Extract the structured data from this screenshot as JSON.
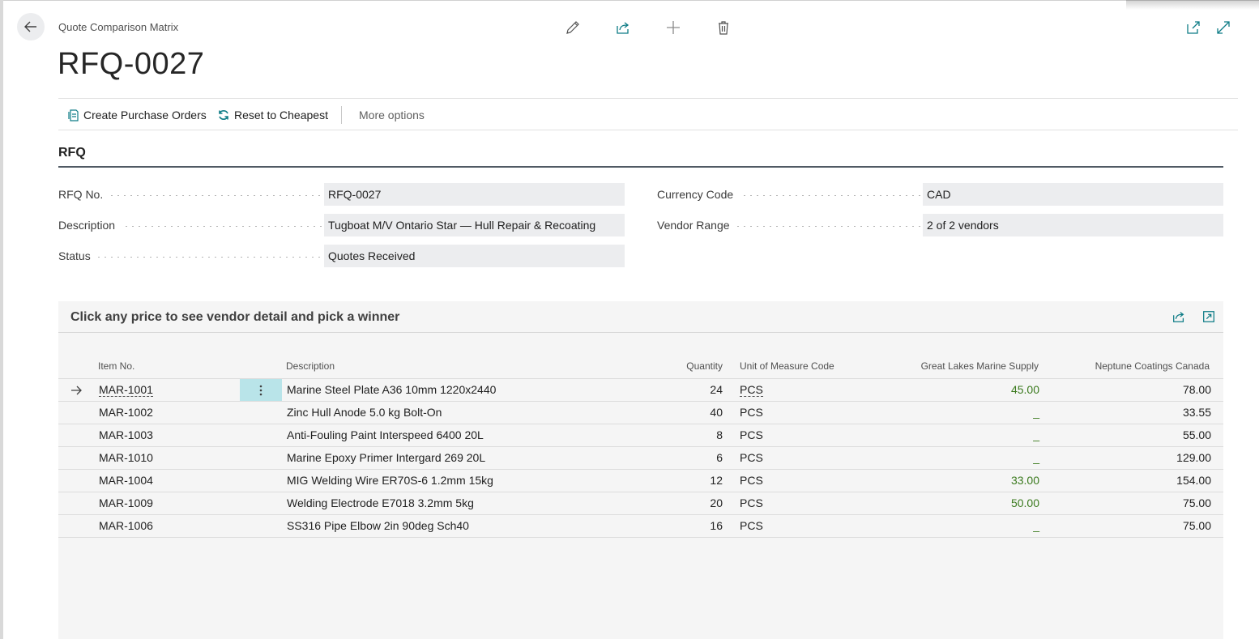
{
  "header": {
    "breadcrumb": "Quote Comparison Matrix",
    "title": "RFQ-0027",
    "toolbar_icons": [
      "pencil-icon",
      "share-icon",
      "plus-icon",
      "trash-icon",
      "open-new-window-icon",
      "expand-icon"
    ]
  },
  "actions": {
    "create_po": "Create Purchase Orders",
    "reset_cheapest": "Reset to Cheapest",
    "more_options": "More options"
  },
  "rfq": {
    "section_title": "RFQ",
    "rfq_no_label": "RFQ No.",
    "rfq_no": "RFQ-0027",
    "description_label": "Description",
    "description": "Tugboat M/V Ontario Star — Hull Repair & Recoating",
    "status_label": "Status",
    "status": "Quotes Received",
    "currency_label": "Currency Code",
    "currency": "CAD",
    "vendor_range_label": "Vendor Range",
    "vendor_range": "2 of 2 vendors"
  },
  "matrix": {
    "caption": "Click any price to see vendor detail and pick a winner",
    "columns": {
      "item_no": "Item No.",
      "description": "Description",
      "quantity": "Quantity",
      "uom": "Unit of Measure Code",
      "vendor1": "Great Lakes Marine Supply",
      "vendor2": "Neptune Coatings Canada"
    },
    "rows": [
      {
        "item_no": "MAR-1001",
        "description": "Marine Steel Plate A36 10mm 1220x2440",
        "quantity": "24",
        "uom": "PCS",
        "vendor1": "45.00",
        "vendor2": "78.00"
      },
      {
        "item_no": "MAR-1002",
        "description": "Zinc Hull Anode 5.0 kg Bolt-On",
        "quantity": "40",
        "uom": "PCS",
        "vendor1": "_",
        "vendor2": "33.55"
      },
      {
        "item_no": "MAR-1003",
        "description": "Anti-Fouling Paint Interspeed 6400 20L",
        "quantity": "8",
        "uom": "PCS",
        "vendor1": "_",
        "vendor2": "55.00"
      },
      {
        "item_no": "MAR-1010",
        "description": "Marine Epoxy Primer Intergard 269 20L",
        "quantity": "6",
        "uom": "PCS",
        "vendor1": "_",
        "vendor2": "129.00"
      },
      {
        "item_no": "MAR-1004",
        "description": "MIG Welding Wire ER70S-6 1.2mm 15kg",
        "quantity": "12",
        "uom": "PCS",
        "vendor1": "33.00",
        "vendor2": "154.00"
      },
      {
        "item_no": "MAR-1009",
        "description": "Welding Electrode E7018 3.2mm 5kg",
        "quantity": "20",
        "uom": "PCS",
        "vendor1": "50.00",
        "vendor2": "75.00"
      },
      {
        "item_no": "MAR-1006",
        "description": "SS316 Pipe Elbow 2in 90deg Sch40",
        "quantity": "16",
        "uom": "PCS",
        "vendor1": "_",
        "vendor2": "75.00"
      }
    ]
  },
  "colors": {
    "accent_teal": "#b9e4e9",
    "winner_green": "#3b7a1e",
    "field_bg": "#ecedef",
    "icon_teal": "#0e7c86"
  }
}
